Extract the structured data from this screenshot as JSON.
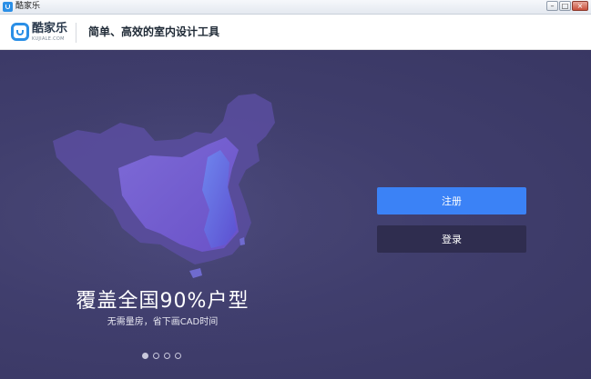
{
  "window": {
    "title": "酷家乐",
    "controls": [
      "–",
      "□",
      "×"
    ]
  },
  "header": {
    "logo_text": "酷家乐",
    "logo_sub": "KUJIALE.COM",
    "slogan": "简单、高效的室内设计工具"
  },
  "hero": {
    "headline": "覆盖全国90%户型",
    "subline": "无需量房，省下画CAD时间",
    "carousel_total": 4,
    "carousel_active": 1
  },
  "actions": {
    "register_label": "注册",
    "login_label": "登录"
  },
  "colors": {
    "brand": "#2b8fe6",
    "background": "#403e6d",
    "register_button": "#3b82f6",
    "login_button": "#2f2d4f"
  }
}
